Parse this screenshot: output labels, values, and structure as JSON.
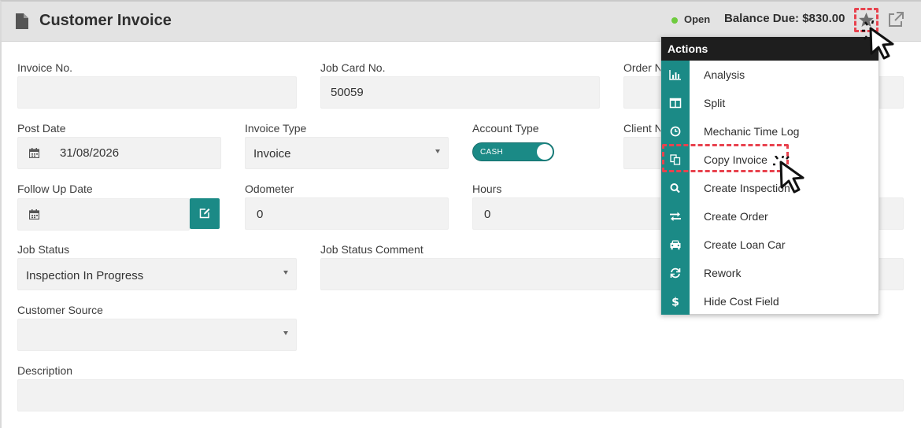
{
  "colors": {
    "teal": "#1b8a86",
    "status_green": "#6ecb3e",
    "highlight_red": "#e8424e",
    "menu_header": "#1e1e1e"
  },
  "header": {
    "title": "Customer Invoice",
    "status": "Open",
    "balance": "Balance Due: $830.00",
    "icons": [
      "document-icon",
      "star-icon",
      "external-link-icon"
    ]
  },
  "form": {
    "invoice_no": {
      "label": "Invoice No.",
      "value": ""
    },
    "job_card_no": {
      "label": "Job Card No.",
      "value": "50059"
    },
    "order_no": {
      "label": "Order N"
    },
    "post_date": {
      "label": "Post Date",
      "value": "31/08/2026"
    },
    "invoice_type": {
      "label": "Invoice Type",
      "value": "Invoice"
    },
    "account_type": {
      "label": "Account Type",
      "toggle": "CASH"
    },
    "client": {
      "label": "Client N"
    },
    "follow_up_date": {
      "label": "Follow Up Date",
      "value": ""
    },
    "odometer": {
      "label": "Odometer",
      "value": "0"
    },
    "hours": {
      "label": "Hours",
      "value": "0"
    },
    "job_status": {
      "label": "Job Status",
      "value": "Inspection In Progress"
    },
    "job_status_comment": {
      "label": "Job Status Comment",
      "value": ""
    },
    "customer_source": {
      "label": "Customer Source",
      "value": ""
    },
    "description": {
      "label": "Description",
      "value": ""
    }
  },
  "actions_menu": {
    "title": "Actions",
    "items": [
      {
        "label": "Analysis",
        "icon": "bar-chart-icon"
      },
      {
        "label": "Split",
        "icon": "columns-icon"
      },
      {
        "label": "Mechanic Time Log",
        "icon": "clock-icon"
      },
      {
        "label": "Copy Invoice",
        "icon": "copy-icon"
      },
      {
        "label": "Create Inspection",
        "icon": "search-icon"
      },
      {
        "label": "Create Order",
        "icon": "exchange-icon"
      },
      {
        "label": "Create Loan Car",
        "icon": "car-icon"
      },
      {
        "label": "Rework",
        "icon": "refresh-icon"
      },
      {
        "label": "Hide Cost Field",
        "icon": "dollar-icon"
      }
    ]
  }
}
